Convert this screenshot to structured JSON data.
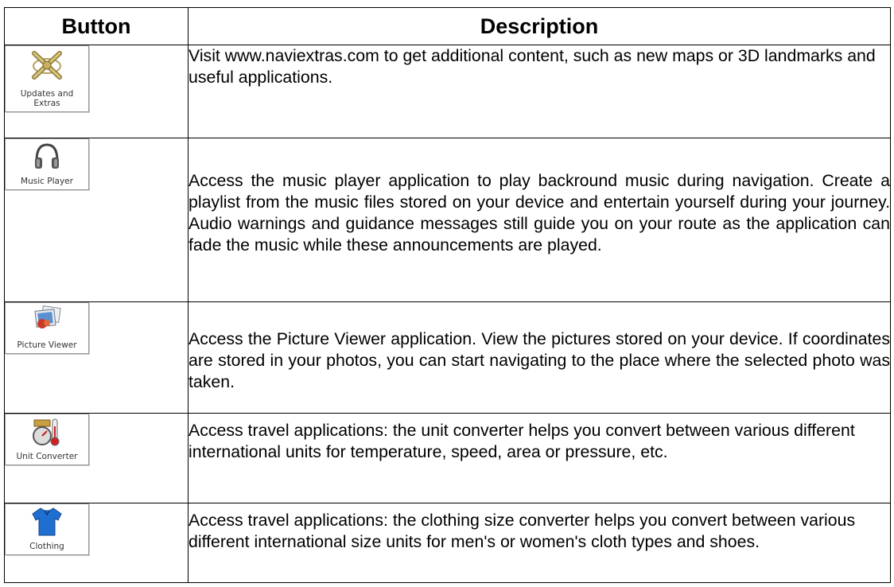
{
  "table": {
    "headers": {
      "button": "Button",
      "description": "Description"
    },
    "rows": [
      {
        "label_line1": "Updates and",
        "label_line2": "Extras",
        "icon": "satellite-x-icon",
        "description": "Visit www.naviextras.com to get additional content, such as new maps or 3D landmarks and useful applications."
      },
      {
        "label": "Music Player",
        "icon": "headphones-icon",
        "description": "Access the music player application to play backround music during navigation. Create a playlist from the music files stored on your device and entertain yourself during your journey. Audio warnings and guidance messages still guide you on your route as the application can fade the music while these announcements are played."
      },
      {
        "label": "Picture Viewer",
        "icon": "photos-icon",
        "description": "Access the Picture Viewer application. View the pictures stored on your device. If coordinates are stored in your photos, you can start navigating to the place where the selected photo was taken."
      },
      {
        "label": "Unit Converter",
        "icon": "gauge-thermometer-icon",
        "description": "Access travel applications: the unit converter helps you convert between various different international units for temperature, speed, area or pressure, etc."
      },
      {
        "label": "Clothing",
        "icon": "shirt-icon",
        "description": "Access travel applications: the clothing size converter helps you convert between various different international size units for men's or women's cloth types and shoes."
      }
    ]
  }
}
